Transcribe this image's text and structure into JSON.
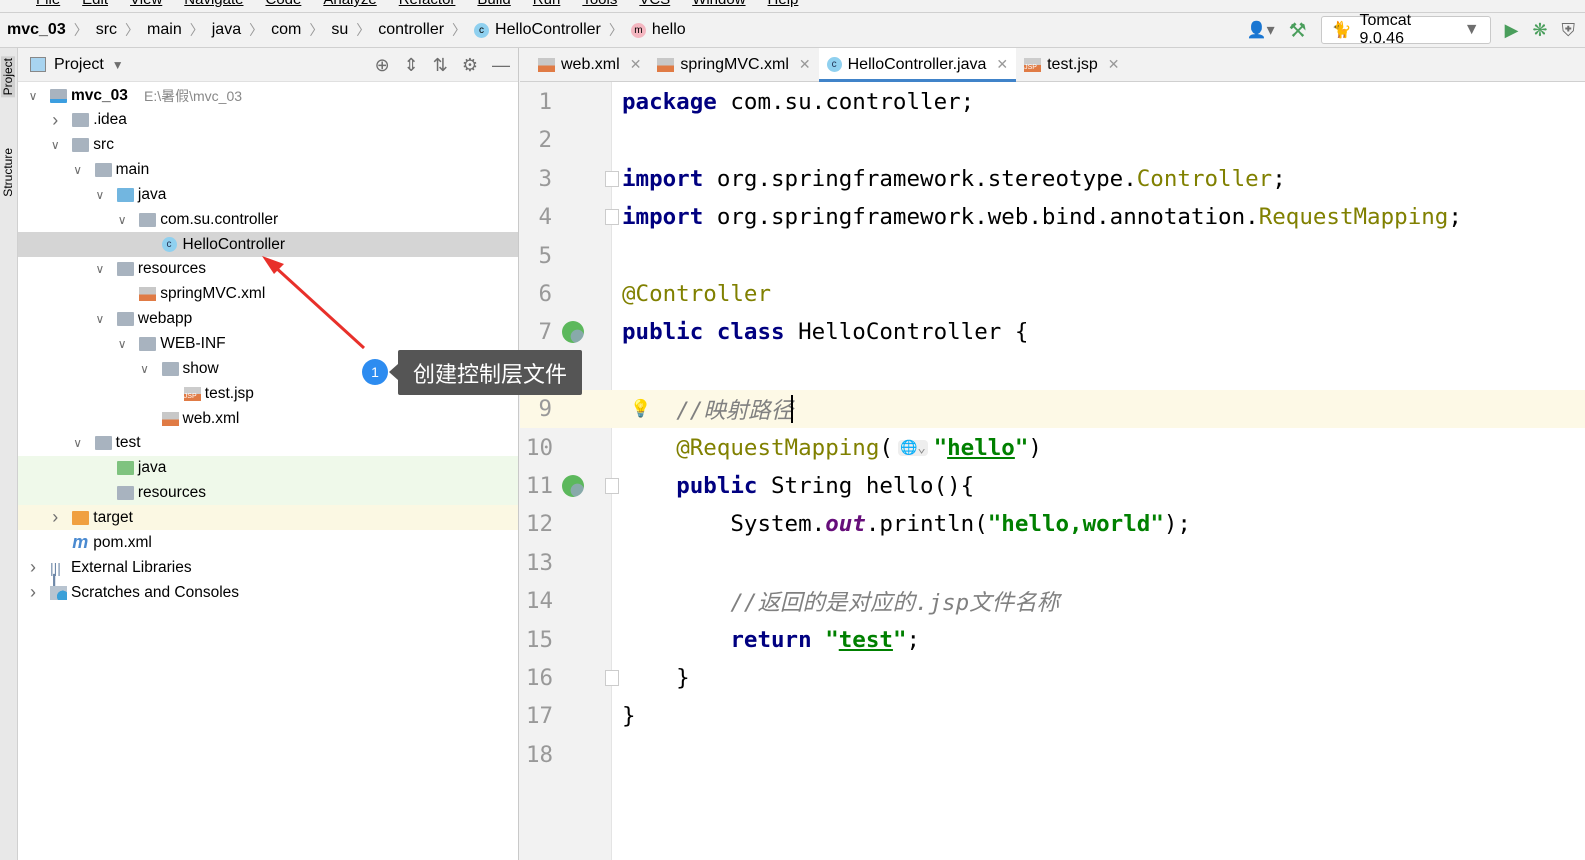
{
  "menu": [
    "File",
    "Edit",
    "View",
    "Navigate",
    "Code",
    "Analyze",
    "Refactor",
    "Build",
    "Run",
    "Tools",
    "VCS",
    "Window",
    "Help"
  ],
  "breadcrumb": [
    {
      "label": "mvc_03",
      "bold": true
    },
    {
      "label": "src"
    },
    {
      "label": "main"
    },
    {
      "label": "java"
    },
    {
      "label": "com"
    },
    {
      "label": "su"
    },
    {
      "label": "controller"
    },
    {
      "label": "HelloController",
      "icon": "class-icon"
    },
    {
      "label": "hello",
      "icon": "method-icon"
    }
  ],
  "toolbar": {
    "run_config": "Tomcat 9.0.46"
  },
  "side_labels": {
    "project": "Project",
    "structure": "Structure"
  },
  "project": {
    "title": "Project",
    "tree": [
      {
        "level": 0,
        "arrow": "down",
        "icon": "module",
        "label": "mvc_03",
        "bold": true,
        "hint": "E:\\暑假\\mvc_03"
      },
      {
        "level": 1,
        "arrow": "right",
        "icon": "folder",
        "label": ".idea"
      },
      {
        "level": 1,
        "arrow": "down",
        "icon": "folder",
        "label": "src"
      },
      {
        "level": 2,
        "arrow": "down",
        "icon": "folder",
        "label": "main"
      },
      {
        "level": 3,
        "arrow": "down",
        "icon": "src-folder",
        "label": "java"
      },
      {
        "level": 4,
        "arrow": "down",
        "icon": "package",
        "label": "com.su.controller"
      },
      {
        "level": 5,
        "icon": "class",
        "label": "HelloController",
        "selected": true
      },
      {
        "level": 3,
        "arrow": "down",
        "icon": "res-folder",
        "label": "resources"
      },
      {
        "level": 4,
        "icon": "xml",
        "label": "springMVC.xml"
      },
      {
        "level": 3,
        "arrow": "down",
        "icon": "web-folder",
        "label": "webapp"
      },
      {
        "level": 4,
        "arrow": "down",
        "icon": "folder",
        "label": "WEB-INF"
      },
      {
        "level": 5,
        "arrow": "down",
        "icon": "folder",
        "label": "show"
      },
      {
        "level": 6,
        "icon": "jsp",
        "label": "test.jsp"
      },
      {
        "level": 5,
        "icon": "xml",
        "label": "web.xml"
      },
      {
        "level": 2,
        "arrow": "down",
        "icon": "folder",
        "label": "test"
      },
      {
        "level": 3,
        "icon": "test-folder",
        "label": "java",
        "bg": "test"
      },
      {
        "level": 3,
        "icon": "test-res-folder",
        "label": "resources",
        "bg": "test"
      },
      {
        "level": 1,
        "arrow": "right",
        "icon": "excluded-folder",
        "label": "target",
        "bg": "excluded"
      },
      {
        "level": 1,
        "icon": "maven",
        "label": "pom.xml"
      },
      {
        "level": 0,
        "arrow": "right",
        "icon": "libraries",
        "label": "External Libraries"
      },
      {
        "level": 0,
        "arrow": "right",
        "icon": "scratches",
        "label": "Scratches and Consoles"
      }
    ]
  },
  "tabs": [
    {
      "label": "web.xml",
      "icon": "xml"
    },
    {
      "label": "springMVC.xml",
      "icon": "xml"
    },
    {
      "label": "HelloController.java",
      "icon": "class",
      "active": true
    },
    {
      "label": "test.jsp",
      "icon": "jsp"
    }
  ],
  "code": [
    [
      [
        "kw",
        "package"
      ],
      [
        "pl",
        " com.su.controller;"
      ]
    ],
    [],
    [
      [
        "kw",
        "import"
      ],
      [
        "pl",
        " org.springframework.stereotype."
      ],
      [
        "an",
        "Controller"
      ],
      [
        "pl",
        ";"
      ]
    ],
    [
      [
        "kw",
        "import"
      ],
      [
        "pl",
        " org.springframework.web.bind.annotation."
      ],
      [
        "an",
        "RequestMapping"
      ],
      [
        "pl",
        ";"
      ]
    ],
    [],
    [
      [
        "an",
        "@Controller"
      ]
    ],
    [
      [
        "kw",
        "public class"
      ],
      [
        "pl",
        " HelloController {"
      ]
    ],
    [],
    [
      [
        "pl",
        "    "
      ],
      [
        "cm",
        "//映射路径"
      ]
    ],
    [
      [
        "pl",
        "    "
      ],
      [
        "an",
        "@RequestMapping"
      ],
      [
        "pl",
        "(   "
      ],
      [
        "str",
        "\""
      ],
      [
        "strl",
        "hello"
      ],
      [
        "str",
        "\""
      ],
      [
        "pl",
        ")"
      ]
    ],
    [
      [
        "pl",
        "    "
      ],
      [
        "kw",
        "public"
      ],
      [
        "pl",
        " String hello(){"
      ]
    ],
    [
      [
        "pl",
        "        System."
      ],
      [
        "fld",
        "out"
      ],
      [
        "pl",
        ".println("
      ],
      [
        "str",
        "\"hello,world\""
      ],
      [
        "pl",
        ");"
      ]
    ],
    [],
    [
      [
        "pl",
        "        "
      ],
      [
        "cm",
        "//返回的是对应的.jsp文件名称"
      ]
    ],
    [
      [
        "pl",
        "        "
      ],
      [
        "kw",
        "return "
      ],
      [
        "str",
        "\""
      ],
      [
        "strl",
        "test"
      ],
      [
        "str",
        "\""
      ],
      [
        "pl",
        ";"
      ]
    ],
    [
      [
        "pl",
        "    }"
      ]
    ],
    [
      [
        "pl",
        "}"
      ]
    ],
    []
  ],
  "current_line": 9,
  "annotation": {
    "number": "1",
    "text": "创建控制层文件"
  },
  "colors": {
    "accent": "#4083c9",
    "arrow": "#e8302a",
    "badge": "#2d8cf0"
  }
}
